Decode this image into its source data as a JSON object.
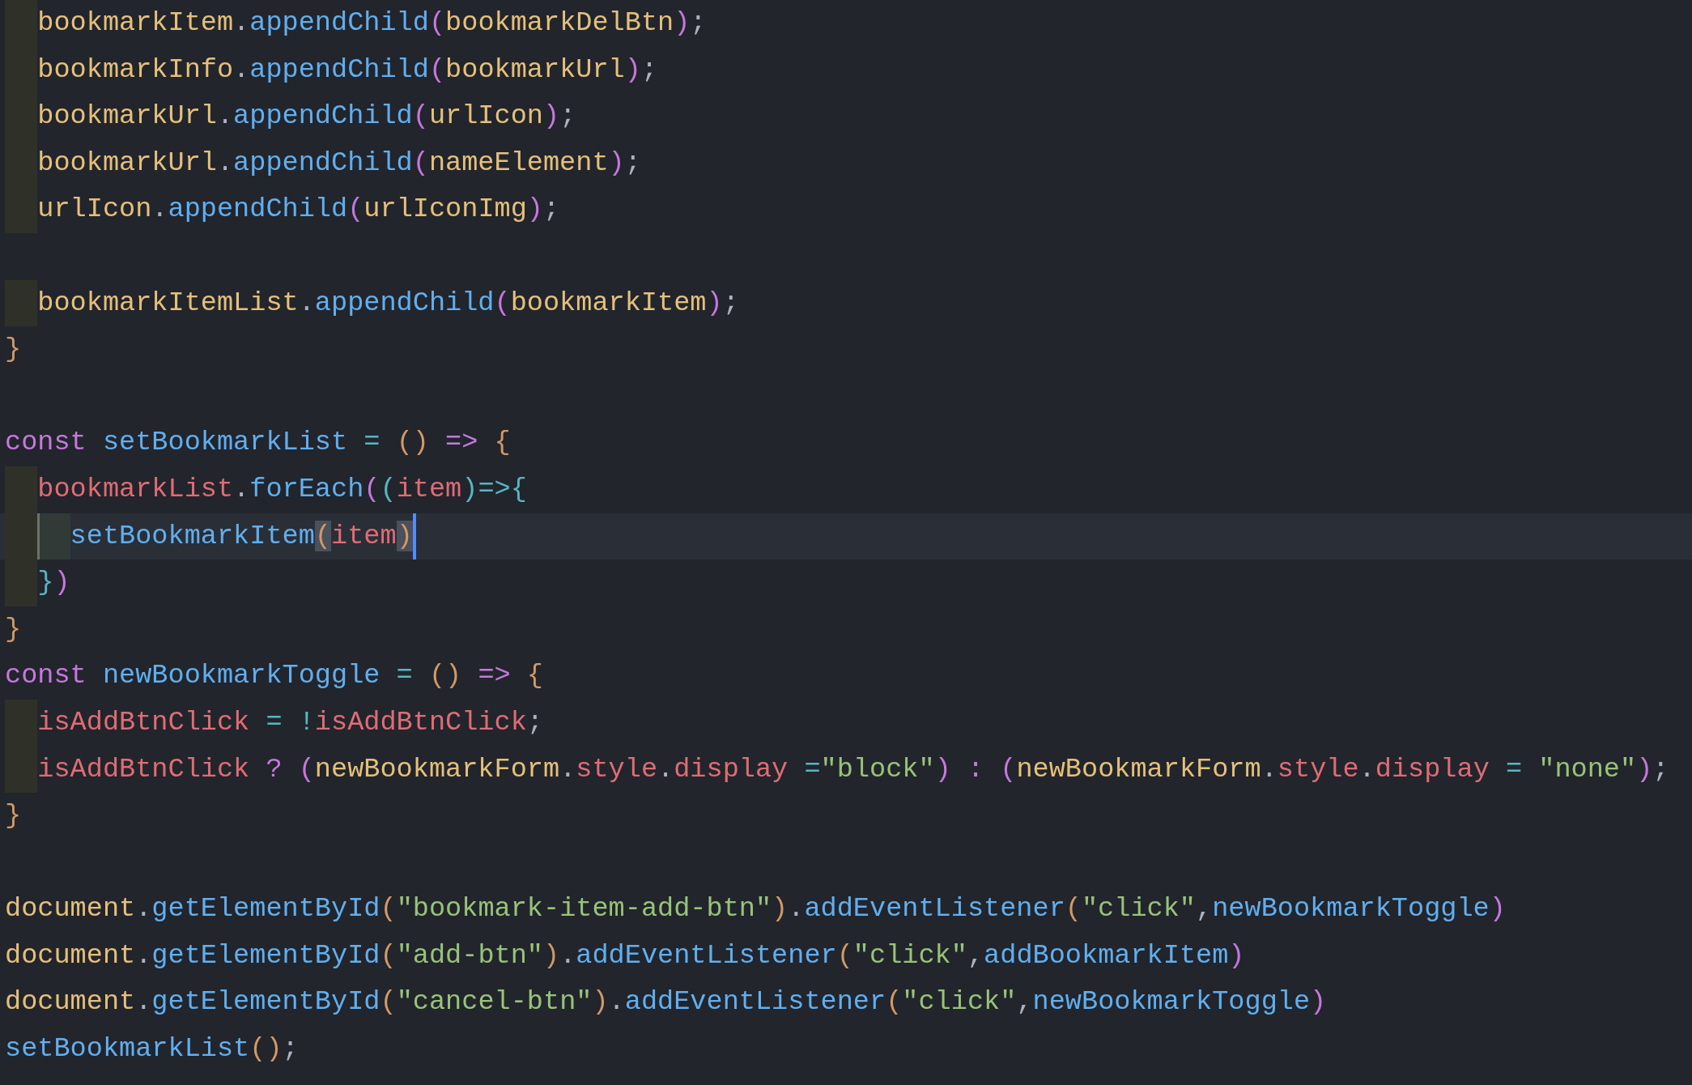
{
  "editor": {
    "lines": [
      {
        "kind": "block",
        "children": [
          {
            "kind": "code",
            "tokens": [
              {
                "text": "bookmarkItem",
                "kind": "var"
              },
              {
                "text": ".",
                "kind": "punc"
              },
              {
                "text": "appendChild",
                "kind": "fn"
              },
              {
                "text": "(",
                "kind": "bracket2"
              },
              {
                "text": "bookmarkDelBtn",
                "kind": "var"
              },
              {
                "text": ")",
                "kind": "bracket2"
              },
              {
                "text": ";",
                "kind": "punc"
              }
            ]
          },
          {
            "kind": "code",
            "tokens": [
              {
                "text": "bookmarkInfo",
                "kind": "var"
              },
              {
                "text": ".",
                "kind": "punc"
              },
              {
                "text": "appendChild",
                "kind": "fn"
              },
              {
                "text": "(",
                "kind": "bracket2"
              },
              {
                "text": "bookmarkUrl",
                "kind": "var"
              },
              {
                "text": ")",
                "kind": "bracket2"
              },
              {
                "text": ";",
                "kind": "punc"
              }
            ]
          },
          {
            "kind": "code",
            "tokens": [
              {
                "text": "bookmarkUrl",
                "kind": "var"
              },
              {
                "text": ".",
                "kind": "punc"
              },
              {
                "text": "appendChild",
                "kind": "fn"
              },
              {
                "text": "(",
                "kind": "bracket2"
              },
              {
                "text": "urlIcon",
                "kind": "var"
              },
              {
                "text": ")",
                "kind": "bracket2"
              },
              {
                "text": ";",
                "kind": "punc"
              }
            ]
          },
          {
            "kind": "code",
            "tokens": [
              {
                "text": "bookmarkUrl",
                "kind": "var"
              },
              {
                "text": ".",
                "kind": "punc"
              },
              {
                "text": "appendChild",
                "kind": "fn"
              },
              {
                "text": "(",
                "kind": "bracket2"
              },
              {
                "text": "nameElement",
                "kind": "var"
              },
              {
                "text": ")",
                "kind": "bracket2"
              },
              {
                "text": ";",
                "kind": "punc"
              }
            ]
          },
          {
            "kind": "code",
            "tokens": [
              {
                "text": "urlIcon",
                "kind": "var"
              },
              {
                "text": ".",
                "kind": "punc"
              },
              {
                "text": "appendChild",
                "kind": "fn"
              },
              {
                "text": "(",
                "kind": "bracket2"
              },
              {
                "text": "urlIconImg",
                "kind": "var"
              },
              {
                "text": ")",
                "kind": "bracket2"
              },
              {
                "text": ";",
                "kind": "punc"
              }
            ]
          },
          {
            "kind": "blank"
          },
          {
            "kind": "code",
            "tokens": [
              {
                "text": "bookmarkItemList",
                "kind": "var"
              },
              {
                "text": ".",
                "kind": "punc"
              },
              {
                "text": "appendChild",
                "kind": "fn"
              },
              {
                "text": "(",
                "kind": "bracket2"
              },
              {
                "text": "bookmarkItem",
                "kind": "var"
              },
              {
                "text": ")",
                "kind": "bracket2"
              },
              {
                "text": ";",
                "kind": "punc"
              }
            ]
          }
        ]
      },
      {
        "kind": "code",
        "tokens": [
          {
            "text": "}",
            "kind": "bracket1"
          }
        ]
      },
      {
        "kind": "blank"
      },
      {
        "kind": "code",
        "tokens": [
          {
            "text": "const ",
            "kind": "kw"
          },
          {
            "text": "setBookmarkList",
            "kind": "fn"
          },
          {
            "text": " = ",
            "kind": "op"
          },
          {
            "text": "()",
            "kind": "bracket1"
          },
          {
            "text": " => ",
            "kind": "kw"
          },
          {
            "text": "{",
            "kind": "bracket1"
          }
        ],
        "children": [
          {
            "kind": "code",
            "tokens": [
              {
                "text": "bookmarkList",
                "kind": "prop"
              },
              {
                "text": ".",
                "kind": "punc"
              },
              {
                "text": "forEach",
                "kind": "fn"
              },
              {
                "text": "(",
                "kind": "bracket2"
              },
              {
                "text": "(",
                "kind": "bracket3"
              },
              {
                "text": "item",
                "kind": "prop"
              },
              {
                "text": ")",
                "kind": "bracket3"
              },
              {
                "text": "=>",
                "kind": "op"
              },
              {
                "text": "{",
                "kind": "bracket3"
              }
            ],
            "children": [
              {
                "kind": "code",
                "current": true,
                "cursor": true,
                "tokens": [
                  {
                    "text": "setBookmarkItem",
                    "kind": "fn"
                  },
                  {
                    "text": "(",
                    "kind": "bracket1",
                    "matched": true
                  },
                  {
                    "text": "item",
                    "kind": "prop"
                  },
                  {
                    "text": ")",
                    "kind": "bracket1",
                    "matched": true
                  }
                ]
              }
            ]
          },
          {
            "kind": "code",
            "tokens": [
              {
                "text": "}",
                "kind": "bracket3"
              },
              {
                "text": ")",
                "kind": "bracket2"
              }
            ]
          }
        ]
      },
      {
        "kind": "code",
        "tokens": [
          {
            "text": "}",
            "kind": "bracket1"
          }
        ]
      },
      {
        "kind": "code",
        "tokens": [
          {
            "text": "const ",
            "kind": "kw"
          },
          {
            "text": "newBookmarkToggle",
            "kind": "fn"
          },
          {
            "text": " = ",
            "kind": "op"
          },
          {
            "text": "()",
            "kind": "bracket1"
          },
          {
            "text": " => ",
            "kind": "kw"
          },
          {
            "text": "{",
            "kind": "bracket1"
          }
        ],
        "children": [
          {
            "kind": "code",
            "tokens": [
              {
                "text": "isAddBtnClick",
                "kind": "prop"
              },
              {
                "text": " = !",
                "kind": "op"
              },
              {
                "text": "isAddBtnClick",
                "kind": "prop"
              },
              {
                "text": ";",
                "kind": "punc"
              }
            ]
          },
          {
            "kind": "code",
            "tokens": [
              {
                "text": "isAddBtnClick",
                "kind": "prop"
              },
              {
                "text": " ? ",
                "kind": "kw"
              },
              {
                "text": "(",
                "kind": "bracket2"
              },
              {
                "text": "newBookmarkForm",
                "kind": "var"
              },
              {
                "text": ".",
                "kind": "punc"
              },
              {
                "text": "style",
                "kind": "prop"
              },
              {
                "text": ".",
                "kind": "punc"
              },
              {
                "text": "display",
                "kind": "prop"
              },
              {
                "text": " =",
                "kind": "op"
              },
              {
                "text": "\"block\"",
                "kind": "str"
              },
              {
                "text": ")",
                "kind": "bracket2"
              },
              {
                "text": " : ",
                "kind": "kw"
              },
              {
                "text": "(",
                "kind": "bracket2"
              },
              {
                "text": "newBookmarkForm",
                "kind": "var"
              },
              {
                "text": ".",
                "kind": "punc"
              },
              {
                "text": "style",
                "kind": "prop"
              },
              {
                "text": ".",
                "kind": "punc"
              },
              {
                "text": "display",
                "kind": "prop"
              },
              {
                "text": " = ",
                "kind": "op"
              },
              {
                "text": "\"none\"",
                "kind": "str"
              },
              {
                "text": ")",
                "kind": "bracket2"
              },
              {
                "text": ";",
                "kind": "punc"
              }
            ]
          }
        ]
      },
      {
        "kind": "code",
        "tokens": [
          {
            "text": "}",
            "kind": "bracket1"
          }
        ]
      },
      {
        "kind": "blank"
      },
      {
        "kind": "code",
        "tokens": [
          {
            "text": "document",
            "kind": "var"
          },
          {
            "text": ".",
            "kind": "punc"
          },
          {
            "text": "getElementById",
            "kind": "fn"
          },
          {
            "text": "(",
            "kind": "bracket1"
          },
          {
            "text": "\"bookmark-item-add-btn\"",
            "kind": "str"
          },
          {
            "text": ")",
            "kind": "bracket1"
          },
          {
            "text": ".",
            "kind": "punc"
          },
          {
            "text": "addEventListener",
            "kind": "fn"
          },
          {
            "text": "(",
            "kind": "bracket1"
          },
          {
            "text": "\"click\"",
            "kind": "str"
          },
          {
            "text": ",",
            "kind": "punc"
          },
          {
            "text": "newBookmarkToggle",
            "kind": "fn"
          },
          {
            "text": ")",
            "kind": "bracket2"
          }
        ]
      },
      {
        "kind": "code",
        "tokens": [
          {
            "text": "document",
            "kind": "var"
          },
          {
            "text": ".",
            "kind": "punc"
          },
          {
            "text": "getElementById",
            "kind": "fn"
          },
          {
            "text": "(",
            "kind": "bracket1"
          },
          {
            "text": "\"add-btn\"",
            "kind": "str"
          },
          {
            "text": ")",
            "kind": "bracket1"
          },
          {
            "text": ".",
            "kind": "punc"
          },
          {
            "text": "addEventListener",
            "kind": "fn"
          },
          {
            "text": "(",
            "kind": "bracket1"
          },
          {
            "text": "\"click\"",
            "kind": "str"
          },
          {
            "text": ",",
            "kind": "punc"
          },
          {
            "text": "addBookmarkItem",
            "kind": "fn"
          },
          {
            "text": ")",
            "kind": "bracket2"
          }
        ]
      },
      {
        "kind": "code",
        "tokens": [
          {
            "text": "document",
            "kind": "var"
          },
          {
            "text": ".",
            "kind": "punc"
          },
          {
            "text": "getElementById",
            "kind": "fn"
          },
          {
            "text": "(",
            "kind": "bracket1"
          },
          {
            "text": "\"cancel-btn\"",
            "kind": "str"
          },
          {
            "text": ")",
            "kind": "bracket1"
          },
          {
            "text": ".",
            "kind": "punc"
          },
          {
            "text": "addEventListener",
            "kind": "fn"
          },
          {
            "text": "(",
            "kind": "bracket1"
          },
          {
            "text": "\"click\"",
            "kind": "str"
          },
          {
            "text": ",",
            "kind": "punc"
          },
          {
            "text": "newBookmarkToggle",
            "kind": "fn"
          },
          {
            "text": ")",
            "kind": "bracket2"
          }
        ]
      },
      {
        "kind": "code",
        "tokens": [
          {
            "text": "setBookmarkList",
            "kind": "fn"
          },
          {
            "text": "()",
            "kind": "bracket1"
          },
          {
            "text": ";",
            "kind": "punc"
          }
        ]
      }
    ]
  }
}
